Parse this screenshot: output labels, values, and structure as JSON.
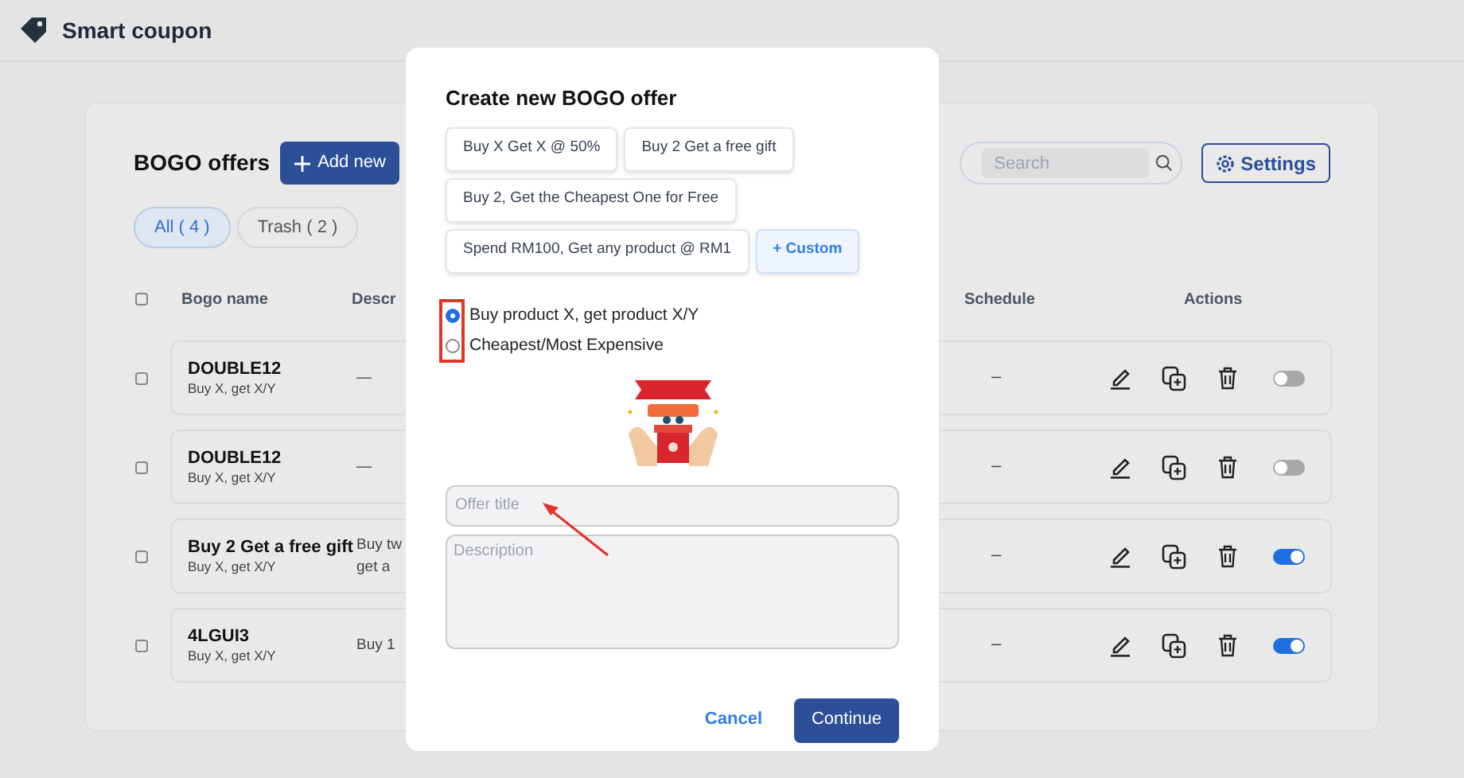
{
  "app": {
    "title": "Smart coupon"
  },
  "page": {
    "title": "BOGO offers",
    "add_button": "Add new",
    "search": {
      "placeholder": "Search"
    },
    "settings_button": "Settings"
  },
  "filters": [
    {
      "label": "All ( 4 )",
      "selected": true
    },
    {
      "label": "Trash ( 2 )",
      "selected": false
    }
  ],
  "table": {
    "select_all": {
      "checked": false
    },
    "columns": [
      "Bogo name",
      "Descr",
      "Schedule",
      "Actions"
    ],
    "rows": [
      {
        "checked": false,
        "name": "DOUBLE12",
        "type": "Buy X, get X/Y",
        "description": [
          "—"
        ],
        "schedule": "–",
        "enabled": false
      },
      {
        "checked": false,
        "name": "DOUBLE12",
        "type": "Buy X, get X/Y",
        "description": [
          "—"
        ],
        "schedule": "–",
        "enabled": false
      },
      {
        "checked": false,
        "name": "Buy 2 Get a free gift",
        "type": "Buy X, get X/Y",
        "description": [
          "Buy tw",
          "get a"
        ],
        "schedule": "–",
        "enabled": true
      },
      {
        "checked": false,
        "name": "4LGUI3",
        "type": "Buy X, get X/Y",
        "description": [
          "Buy 1"
        ],
        "schedule": "–",
        "enabled": true
      }
    ]
  },
  "dialog": {
    "title": "Create new BOGO offer",
    "presets": [
      {
        "label": "Buy X Get X @ 50%",
        "kind": "preset"
      },
      {
        "label": "Buy 2 Get a free gift",
        "kind": "preset"
      },
      {
        "label": "Buy 2, Get the Cheapest One for Free",
        "kind": "preset"
      },
      {
        "label": "Spend RM100, Get any product @ RM1",
        "kind": "preset"
      },
      {
        "label": "+ Custom",
        "kind": "custom"
      }
    ],
    "options": [
      {
        "label": "Buy product X, get product X/Y",
        "selected": true
      },
      {
        "label": "Cheapest/Most Expensive",
        "selected": false
      }
    ],
    "title_field": {
      "placeholder": "Offer title"
    },
    "description_field": {
      "placeholder": "Description"
    },
    "cancel": "Cancel",
    "continue": "Continue"
  }
}
